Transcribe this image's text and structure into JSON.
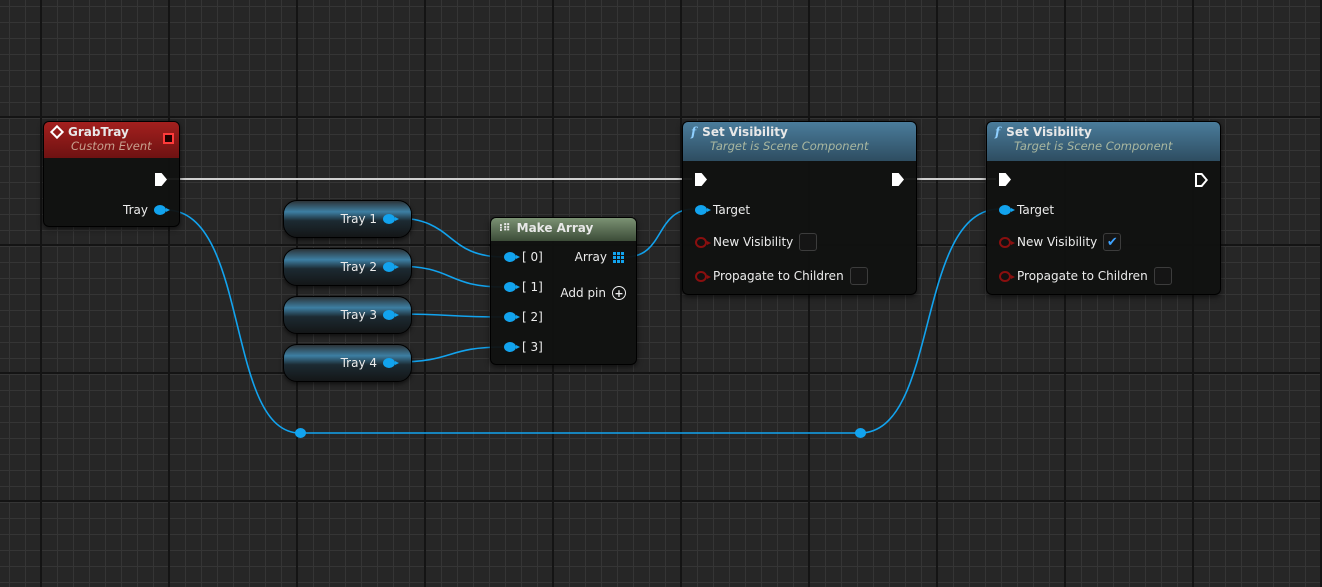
{
  "colors": {
    "object_pin": "#12a3ee",
    "bool_pin": "#8a0f0f",
    "event_header": "#8c1515",
    "function_header": "#3e6a86",
    "make_array_header": "#5e7558",
    "check": "#3da2ff"
  },
  "event_node": {
    "title": "GrabTray",
    "subtitle": "Custom Event",
    "icon": "event-diamond-icon",
    "output_label": "Tray"
  },
  "variables": [
    {
      "label": "Tray 1"
    },
    {
      "label": "Tray 2"
    },
    {
      "label": "Tray 3"
    },
    {
      "label": "Tray 4"
    }
  ],
  "make_array": {
    "title": "Make Array",
    "inputs": [
      "[ 0]",
      "[ 1]",
      "[ 2]",
      "[ 3]"
    ],
    "output_label": "Array",
    "add_pin_label": "Add pin"
  },
  "set_visibility_nodes": [
    {
      "title": "Set Visibility",
      "subtitle": "Target is Scene Component",
      "target_label": "Target",
      "new_visibility_label": "New Visibility",
      "new_visibility": false,
      "propagate_label": "Propagate to Children",
      "propagate": false
    },
    {
      "title": "Set Visibility",
      "subtitle": "Target is Scene Component",
      "target_label": "Target",
      "new_visibility_label": "New Visibility",
      "new_visibility": true,
      "propagate_label": "Propagate to Children",
      "propagate": false
    }
  ]
}
